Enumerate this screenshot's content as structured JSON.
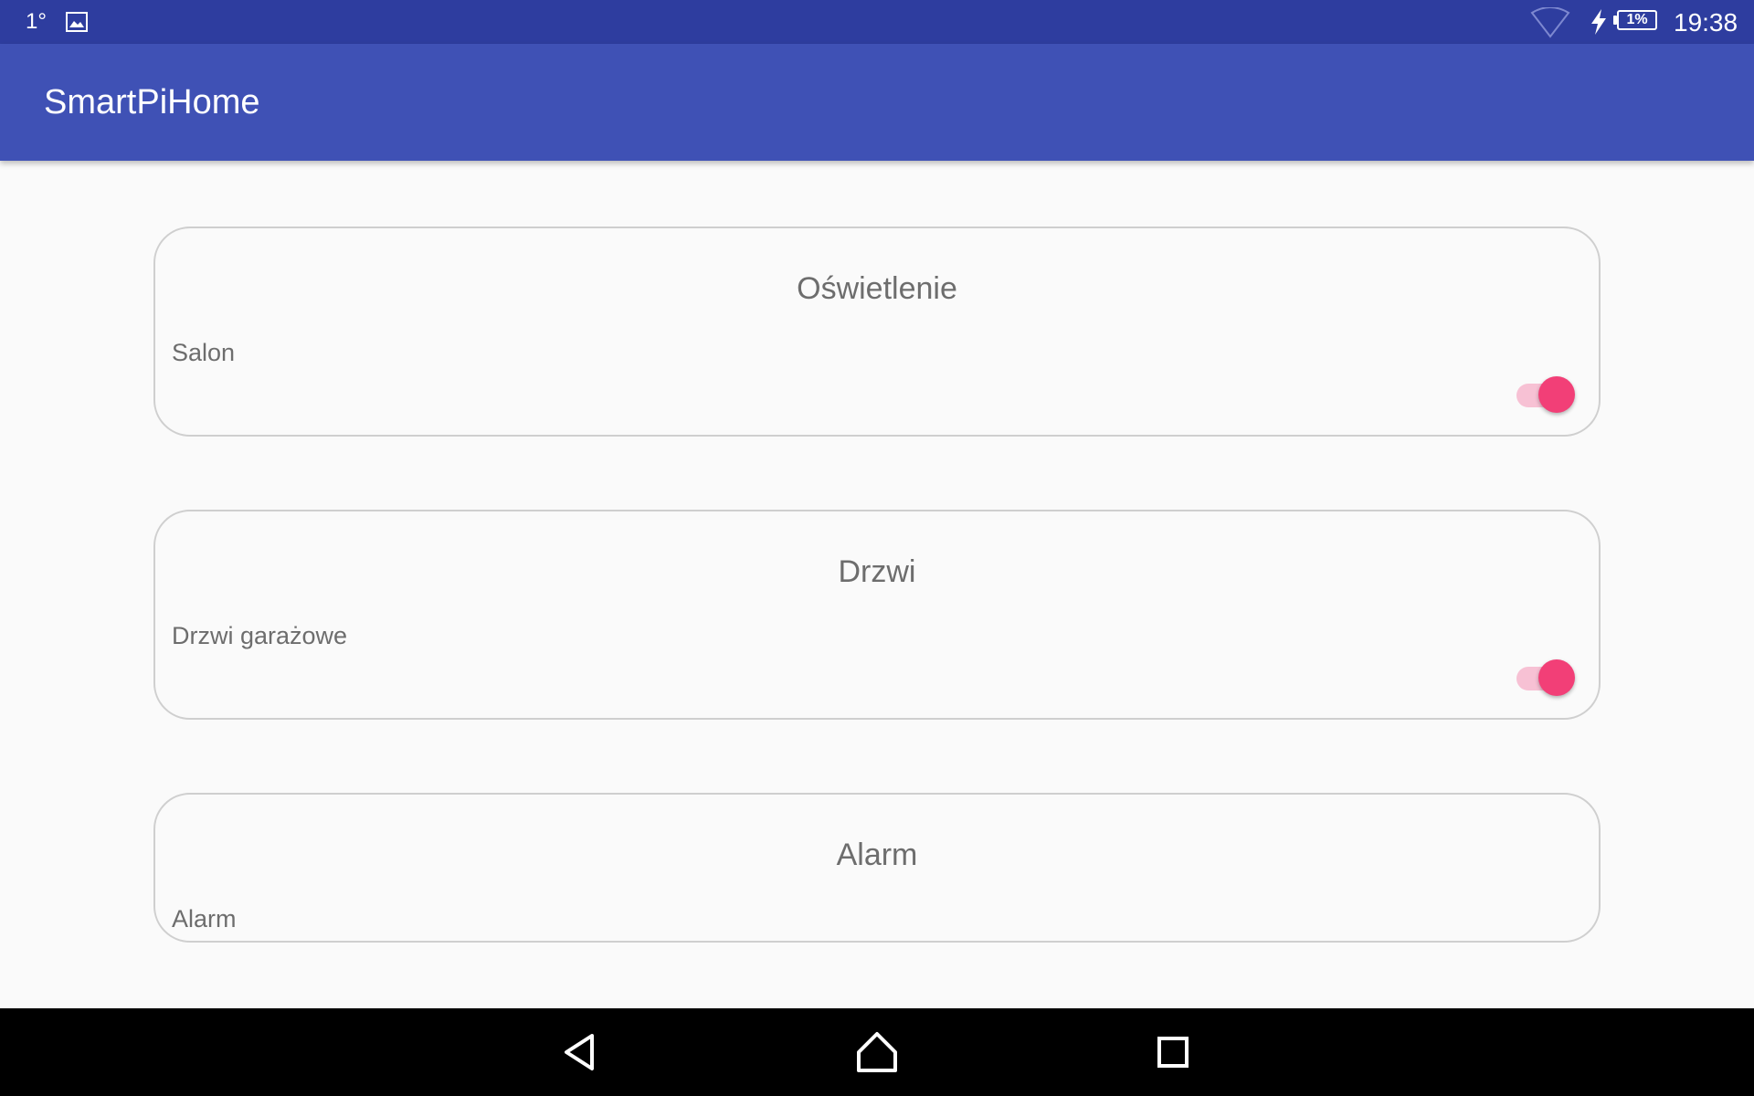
{
  "status_bar": {
    "temperature": "1°",
    "battery_percent": "1%",
    "time": "19:38",
    "icons": [
      "image-icon",
      "wifi-icon",
      "charging-bolt-icon",
      "battery-icon"
    ]
  },
  "app_bar": {
    "title": "SmartPiHome",
    "color": "#3f51b5",
    "status_color": "#2e3d9f"
  },
  "cards": [
    {
      "title": "Oświetlenie",
      "label": "Salon",
      "switch_on": true
    },
    {
      "title": "Drzwi",
      "label": "Drzwi garażowe",
      "switch_on": true
    },
    {
      "title": "Alarm",
      "label": "Alarm"
    }
  ],
  "accent_color": "#f23f77",
  "nav_bar": {
    "icons": [
      "back-icon",
      "home-icon",
      "recents-icon"
    ]
  }
}
